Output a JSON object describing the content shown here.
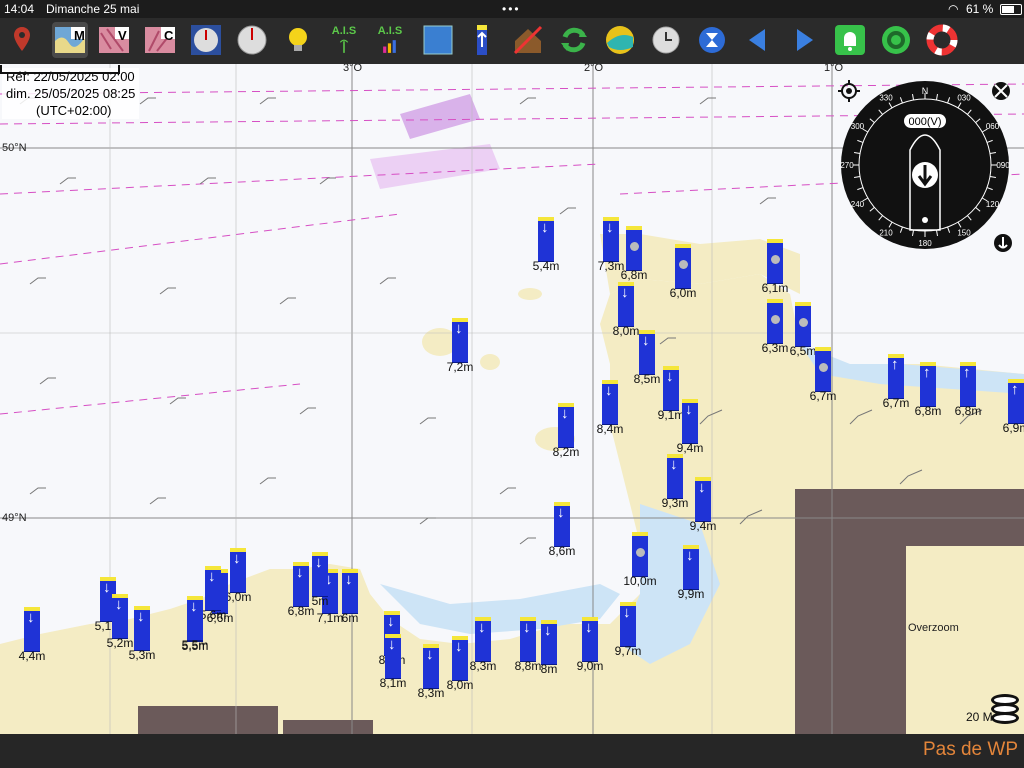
{
  "status_bar": {
    "time": "14:04",
    "date": "Dimanche 25 mai",
    "wifi_icon": "wifi-icon",
    "battery": "61 %"
  },
  "toolbar": {
    "map_badge": "M",
    "vector_badge": "V",
    "cmap_badge": "C",
    "ais_label": "A.I.S",
    "ais2_label": "A.I.S"
  },
  "map": {
    "ref_line1": "Réf: 22/05/2025 02:00",
    "ref_line2": "dim. 25/05/2025 08:25",
    "ref_line3": "(UTC+02:00)",
    "lon_labels": [
      "3°O",
      "2°O",
      "1°O"
    ],
    "lat_labels": [
      "50°N",
      "49°N"
    ],
    "overzoom": "Overzoom",
    "scale_label": "20 M",
    "land_color": "#f4ecc4",
    "shallow_color": "#cde4f6",
    "tide_color": "#1f33d6"
  },
  "compass": {
    "heading": "000(V)",
    "north": "N",
    "ticks": [
      "030",
      "060",
      "090",
      "120",
      "150",
      "180",
      "210",
      "240",
      "270",
      "300",
      "330"
    ]
  },
  "tides": [
    {
      "label": "5,4m",
      "dir": "down"
    },
    {
      "label": "7,3m",
      "dir": "down"
    },
    {
      "label": "6,8m",
      "dir": "dot"
    },
    {
      "label": "6,0m",
      "dir": "dot"
    },
    {
      "label": "6,1m",
      "dir": "dot"
    },
    {
      "label": "6,3m",
      "dir": "dot"
    },
    {
      "label": "8,0m",
      "dir": "down"
    },
    {
      "label": "6,5m",
      "dir": "dot"
    },
    {
      "label": "6,7m",
      "dir": "dot"
    },
    {
      "label": "7,2m",
      "dir": "down"
    },
    {
      "label": "8,5m",
      "dir": "down"
    },
    {
      "label": "8,4m",
      "dir": "down"
    },
    {
      "label": "9,1m",
      "dir": "down"
    },
    {
      "label": "9,4m",
      "dir": "down"
    },
    {
      "label": "8,2m",
      "dir": "down"
    },
    {
      "label": "9,3m",
      "dir": "down"
    },
    {
      "label": "9,4m",
      "dir": "down"
    },
    {
      "label": "8,6m",
      "dir": "down"
    },
    {
      "label": "10,0m",
      "dir": "dot"
    },
    {
      "label": "9,9m",
      "dir": "down"
    },
    {
      "label": "6,7m",
      "dir": "up"
    },
    {
      "label": "6,8m",
      "dir": "up"
    },
    {
      "label": "6,8m",
      "dir": "up"
    },
    {
      "label": "6,9m",
      "dir": "up"
    },
    {
      "label": "5,5m",
      "dir": "down"
    },
    {
      "label": "6,8m",
      "dir": "down"
    },
    {
      "label": "7,1m",
      "dir": "down"
    },
    {
      "label": "6m",
      "dir": "down"
    },
    {
      "label": "5m",
      "dir": "down"
    },
    {
      "label": "6,0m",
      "dir": "down"
    },
    {
      "label": "6,6m",
      "dir": "down"
    },
    {
      "label": "5,6m",
      "dir": "down"
    },
    {
      "label": "5,5m",
      "dir": "down"
    },
    {
      "label": "5,1m",
      "dir": "down"
    },
    {
      "label": "5,2m",
      "dir": "down"
    },
    {
      "label": "5,3m",
      "dir": "down"
    },
    {
      "label": "4,4m",
      "dir": "down"
    },
    {
      "label": "8,1m",
      "dir": "down"
    },
    {
      "label": "8,1m",
      "dir": "down"
    },
    {
      "label": "8,3m",
      "dir": "down"
    },
    {
      "label": "8,0m",
      "dir": "down"
    },
    {
      "label": "8,3m",
      "dir": "down"
    },
    {
      "label": "8,8m",
      "dir": "down"
    },
    {
      "label": "8m",
      "dir": "down"
    },
    {
      "label": "9,0m",
      "dir": "down"
    },
    {
      "label": "9,7m",
      "dir": "down"
    }
  ],
  "bottom_bar": {
    "waypoint": "Pas de WP"
  }
}
